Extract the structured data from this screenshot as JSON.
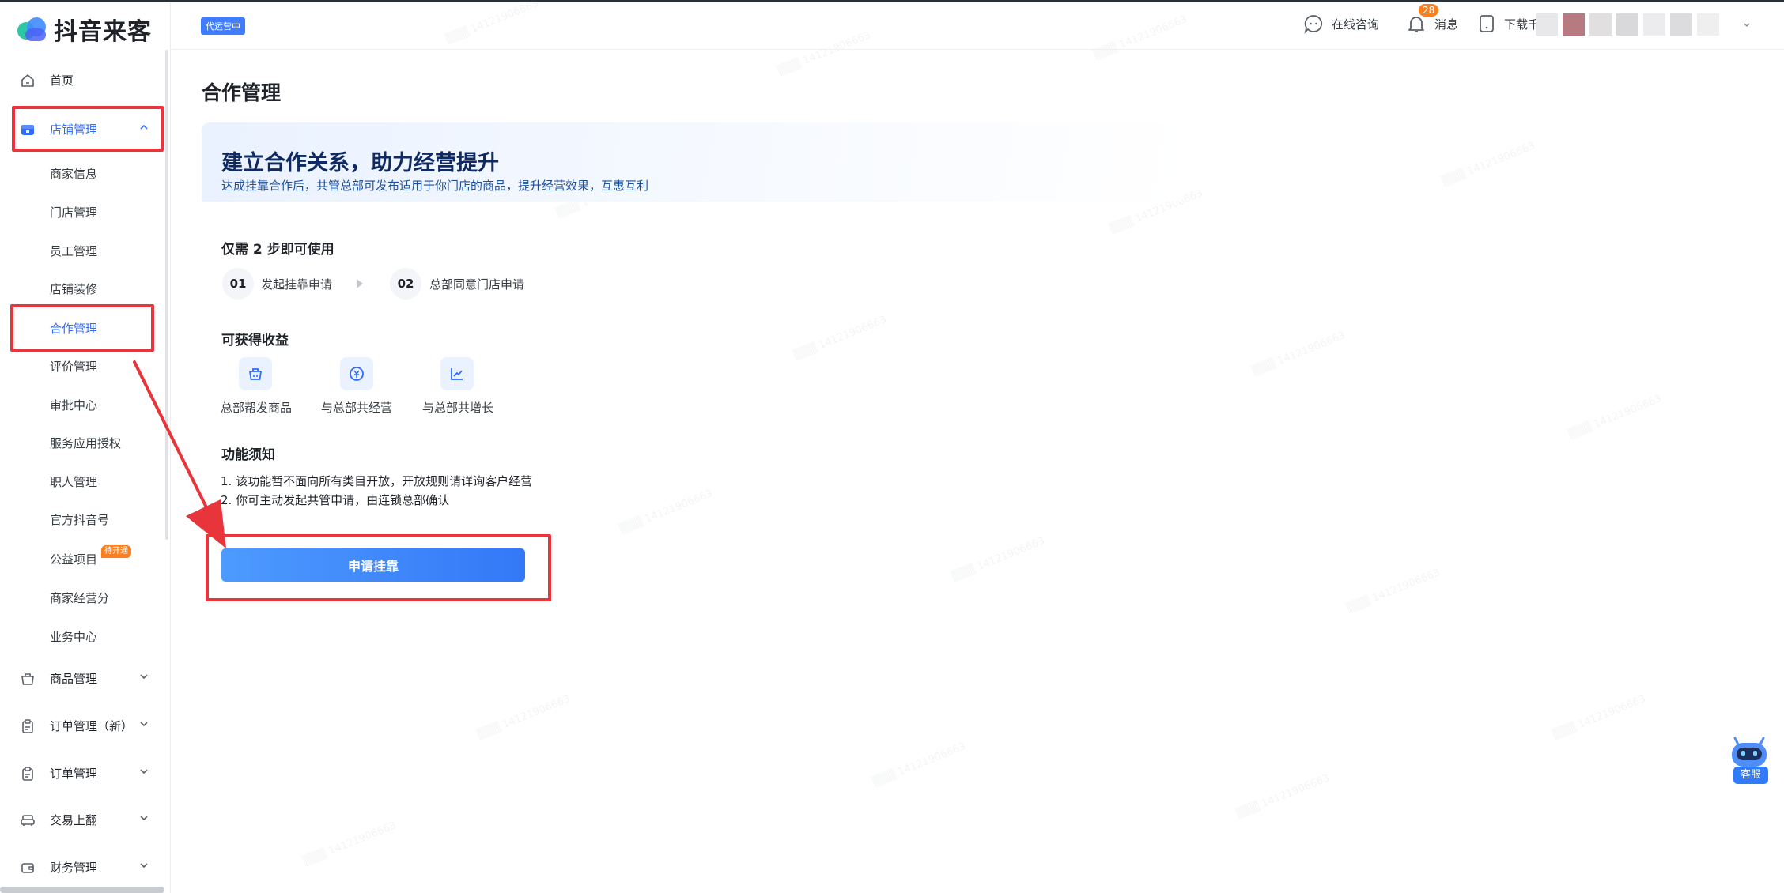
{
  "app": {
    "logo_text": "抖音来客"
  },
  "topbar": {
    "status_tag": "代运营中",
    "online_consult": "在线咨询",
    "messages": "消息",
    "message_count": "28",
    "download": "下载千"
  },
  "sidebar": {
    "home": "首页",
    "store_mgmt": "店铺管理",
    "store_sub": [
      "商家信息",
      "门店管理",
      "员工管理",
      "店铺装修",
      "合作管理",
      "评价管理",
      "审批中心",
      "服务应用授权",
      "职人管理",
      "官方抖音号",
      "公益项目",
      "商家经营分",
      "业务中心"
    ],
    "public_badge": "待开通",
    "goods_mgmt": "商品管理",
    "order_mgmt_new": "订单管理（新）",
    "order_mgmt": "订单管理",
    "trade": "交易上翻",
    "finance": "财务管理"
  },
  "main": {
    "page_title": "合作管理",
    "hero_title": "建立合作关系，助力经营提升",
    "hero_sub": "达成挂靠合作后，共管总部可发布适用于你门店的商品，提升经营效果，互惠互利",
    "steps_title": "仅需 2 步即可使用",
    "steps": [
      {
        "num": "01",
        "label": "发起挂靠申请"
      },
      {
        "num": "02",
        "label": "总部同意门店申请"
      }
    ],
    "benefits_title": "可获得收益",
    "benefits": [
      "总部帮发商品",
      "与总部共经营",
      "与总部共增长"
    ],
    "notice_title": "功能须知",
    "notices": [
      "1. 该功能暂不面向所有类目开放，开放规则请详询客户经营",
      "2. 你可主动发起共管申请，由连锁总部确认"
    ],
    "apply_button": "申请挂靠"
  },
  "service": {
    "label": "客服"
  },
  "colors": {
    "accent": "#2f6bff",
    "highlight_red": "#e8343b",
    "badge_orange": "#ff7d1a"
  }
}
